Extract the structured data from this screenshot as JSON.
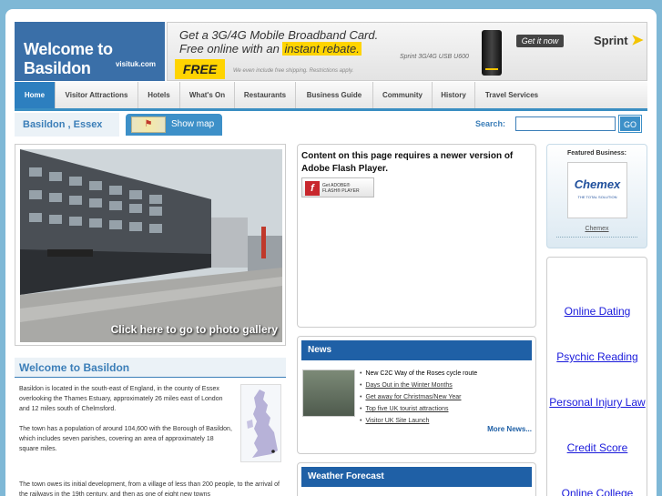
{
  "brand": {
    "title": "Welcome to Basildon",
    "subtitle": "visituk.com"
  },
  "ad": {
    "line1": "Get a 3G/4G Mobile Broadband Card.",
    "line2_pre": "Free online with an ",
    "line2_highlight": "instant rebate.",
    "free": "FREE",
    "fine_print": "We even include free shipping. Restrictions apply.",
    "product": "Sprint 3G/4G USB U600",
    "cta": "Get it now",
    "brand": "Sprint"
  },
  "nav": [
    {
      "label": "Home"
    },
    {
      "label": "Visitor Attractions"
    },
    {
      "label": "Hotels"
    },
    {
      "label": "What's On"
    },
    {
      "label": "Restaurants"
    },
    {
      "label": "Business Guide"
    },
    {
      "label": "Community"
    },
    {
      "label": "History"
    },
    {
      "label": "Travel Services"
    }
  ],
  "location": {
    "name": "Basildon , Essex",
    "show_map": "Show map"
  },
  "search": {
    "label": "Search:",
    "value": "",
    "go": "GO"
  },
  "gallery": {
    "caption": "Click here to go to photo gallery"
  },
  "welcome": {
    "heading": "Welcome to Basildon",
    "p1": "Basildon is located in the south-east of England, in the county of Essex overlooking the Thames Estuary, approximately 26 miles east of London and 12 miles south of Chelmsford.",
    "p2": "The town has a population of around 104,600 with the Borough of Basildon, which includes seven parishes, covering an area of approximately 18 square miles.",
    "p3": "The town owes its initial development, from a village of less than 200 people, to the arrival of the railways in the 19th century, and then as one of eight new towns"
  },
  "flash": {
    "message": "Content on this page requires a newer version of Adobe Flash Player.",
    "badge_line1": "Get ADOBE®",
    "badge_line2": "FLASH® PLAYER"
  },
  "news": {
    "heading": "News",
    "items": [
      {
        "text": "New C2C Way of the Roses cycle route",
        "link": false
      },
      {
        "text": "Days Out in the Winter Months",
        "link": true
      },
      {
        "text": "Get away for Christmas/New Year",
        "link": true
      },
      {
        "text": "Top five UK tourist attractions",
        "link": true
      },
      {
        "text": "Visitor UK Site Launch",
        "link": true
      }
    ],
    "more": "More News..."
  },
  "weather": {
    "heading": "Weather Forecast"
  },
  "featured": {
    "heading": "Featured Business:",
    "logo_name": "Chemex",
    "logo_tagline": "THE TOTAL SOLUTION",
    "link": "Chemex"
  },
  "ad_links": [
    "Online Dating",
    "Psychic Reading",
    "Personal Injury Law",
    "Credit Score",
    "Online College"
  ]
}
